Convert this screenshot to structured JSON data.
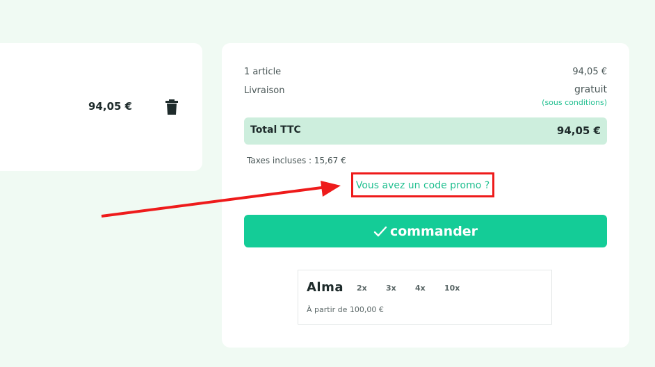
{
  "cart_item": {
    "price": "94,05 €",
    "delete_icon": "trash-icon"
  },
  "summary": {
    "articles_label": "1 article",
    "articles_value": "94,05 €",
    "shipping_label": "Livraison",
    "shipping_value": "gratuit",
    "shipping_conditions": "(sous conditions)",
    "total_label": "Total TTC",
    "total_value": "94,05 €",
    "taxes": "Taxes incluses : 15,67 €",
    "promo_link": "Vous avez un code promo ?",
    "order_button": "commander",
    "order_icon": "check-icon"
  },
  "alma": {
    "logo": "Alma",
    "options": [
      "2x",
      "3x",
      "4x",
      "10x"
    ],
    "from_text": "À partir de 100,00 €"
  },
  "annotation": {
    "arrow_color": "#ee1b1b",
    "highlight_color": "#ee1b1b"
  },
  "colors": {
    "accent": "#14cc97",
    "accent_text": "#1fbf8f",
    "total_bg": "#cdeedd",
    "page_bg": "#f0faf3"
  }
}
